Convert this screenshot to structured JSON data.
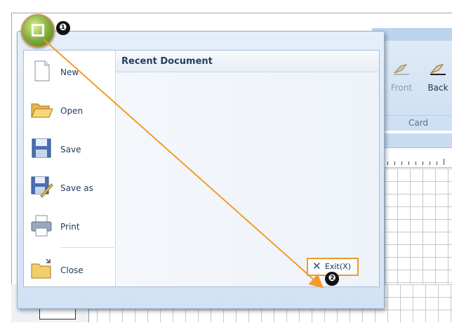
{
  "colors": {
    "accent": "#f39a2a",
    "menu_bg": "#d2e2f5",
    "text": "#243b5c"
  },
  "office_button": {
    "icon": "office-logo-icon"
  },
  "callouts": {
    "step1": "❶",
    "step2": "❷"
  },
  "background_ribbon": {
    "buttons": [
      {
        "label": "Front",
        "icon": "card-front-icon"
      },
      {
        "label": "Back",
        "icon": "card-back-icon"
      }
    ],
    "group_label": "Card"
  },
  "menu": {
    "items": [
      {
        "label": "New",
        "icon": "new-document-icon"
      },
      {
        "label": "Open",
        "icon": "open-folder-icon"
      },
      {
        "label": "Save",
        "icon": "save-disk-icon"
      },
      {
        "label": "Save as",
        "icon": "save-as-icon"
      },
      {
        "label": "Print",
        "icon": "printer-icon"
      },
      {
        "label": "Close",
        "icon": "close-folder-icon"
      }
    ],
    "recent_title": "Recent Document",
    "exit_label": "Exit(X)",
    "exit_icon": "close-x-icon"
  }
}
